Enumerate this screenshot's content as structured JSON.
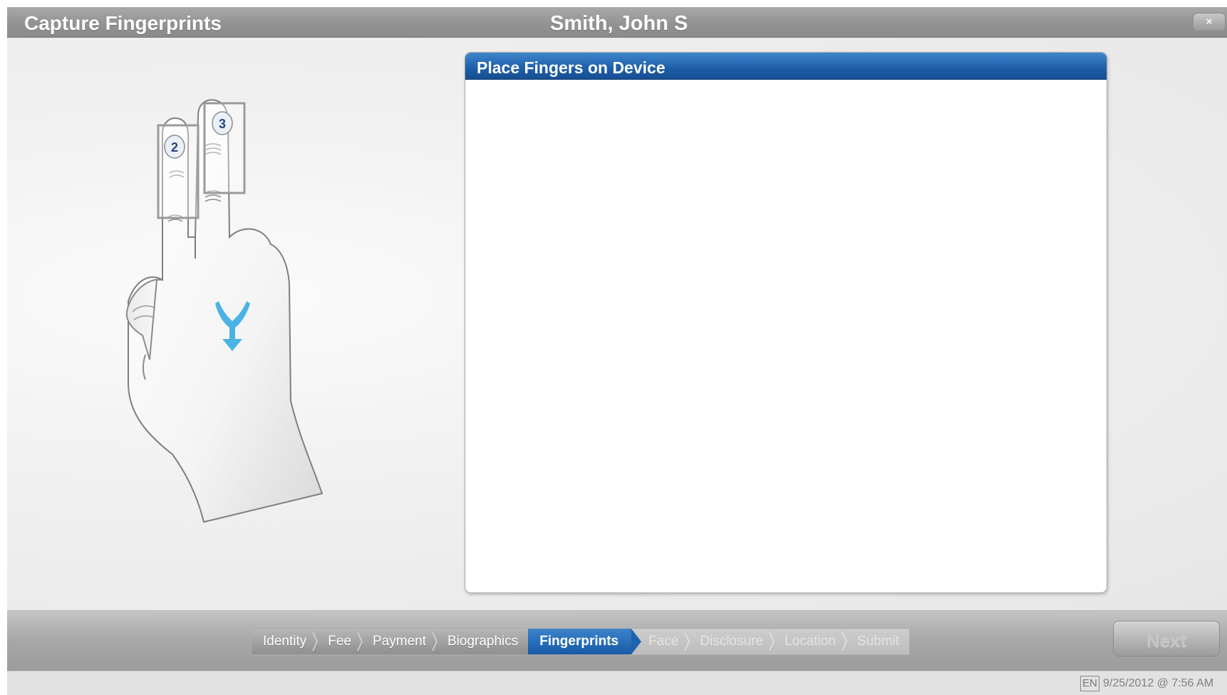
{
  "window": {
    "title": "Capture Fingerprints",
    "patient_name": "Smith, John S",
    "close_icon": "×"
  },
  "illustration": {
    "icon": "hand-two-fingers-icon",
    "finger_labels": [
      "2",
      "3"
    ],
    "arrow_icon": "converge-down-arrow-icon",
    "arrow_color": "#4ab3e6"
  },
  "panel": {
    "title": "Place Fingers on Device",
    "header_color": "#1d5ea8"
  },
  "workflow": {
    "current_index": 4,
    "steps": [
      {
        "label": "Identity",
        "state": "done"
      },
      {
        "label": "Fee",
        "state": "done"
      },
      {
        "label": "Payment",
        "state": "done"
      },
      {
        "label": "Biographics",
        "state": "done"
      },
      {
        "label": "Fingerprints",
        "state": "current"
      },
      {
        "label": "Face",
        "state": "todo"
      },
      {
        "label": "Disclosure",
        "state": "todo"
      },
      {
        "label": "Location",
        "state": "todo"
      },
      {
        "label": "Submit",
        "state": "todo"
      }
    ],
    "next_label": "Next",
    "next_icon": "chevron-right-icon"
  },
  "status": {
    "language": "EN",
    "datetime": "9/25/2012 @ 7:56 AM"
  }
}
